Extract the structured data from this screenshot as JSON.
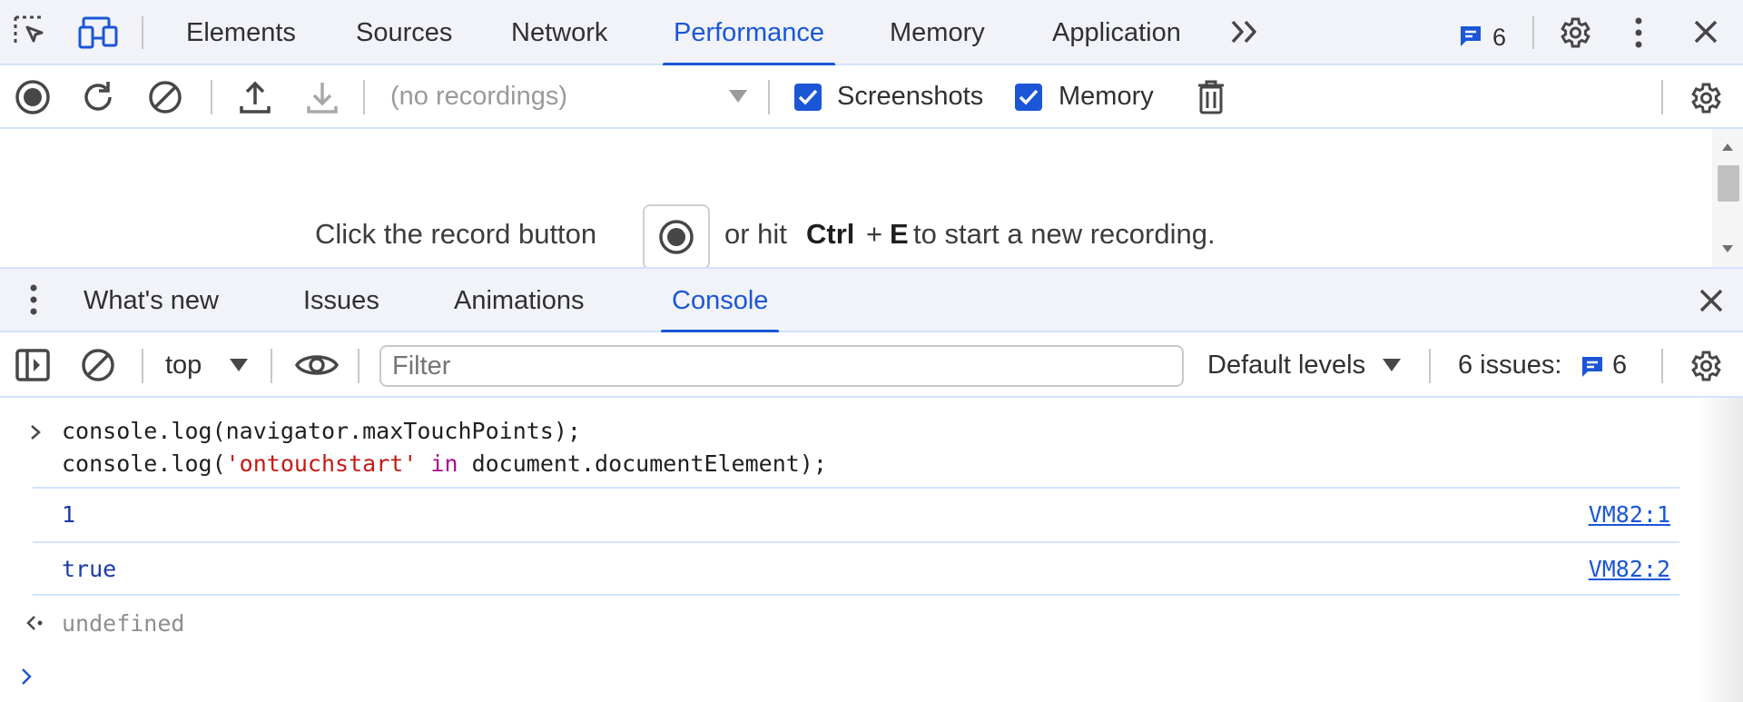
{
  "top_tabs": [
    {
      "label": "Elements",
      "active": false
    },
    {
      "label": "Sources",
      "active": false
    },
    {
      "label": "Network",
      "active": false
    },
    {
      "label": "Performance",
      "active": true
    },
    {
      "label": "Memory",
      "active": false
    },
    {
      "label": "Application",
      "active": false
    }
  ],
  "top_right": {
    "issues_count": "6"
  },
  "perf_toolbar": {
    "recordings_placeholder": "(no recordings)",
    "screenshots_label": "Screenshots",
    "memory_label": "Memory"
  },
  "landing": {
    "prefix": "Click the record button",
    "middle": "or hit",
    "key1": "Ctrl",
    "plus": "+",
    "key2": "E",
    "suffix": "to start a new recording."
  },
  "drawer_tabs": [
    {
      "label": "What's new",
      "active": false
    },
    {
      "label": "Issues",
      "active": false
    },
    {
      "label": "Animations",
      "active": false
    },
    {
      "label": "Console",
      "active": true
    }
  ],
  "console_toolbar": {
    "context": "top",
    "filter_placeholder": "Filter",
    "levels": "Default levels",
    "issues_label": "6 issues:",
    "issues_count": "6"
  },
  "console": {
    "input_line1": {
      "a": "console.log(navigator.maxTouchPoints);"
    },
    "input_line2": {
      "a": "console.log(",
      "s": "'ontouchstart'",
      "b": " ",
      "kw": "in",
      "c": " document.documentElement);"
    },
    "out1": {
      "value": "1",
      "source": "VM82:1"
    },
    "out2": {
      "value": "true",
      "source": "VM82:2"
    },
    "result": "undefined"
  },
  "colors": {
    "accent": "#1a56d6",
    "tab_bar": "#f1f3f9",
    "separator": "#d3e3fd"
  }
}
